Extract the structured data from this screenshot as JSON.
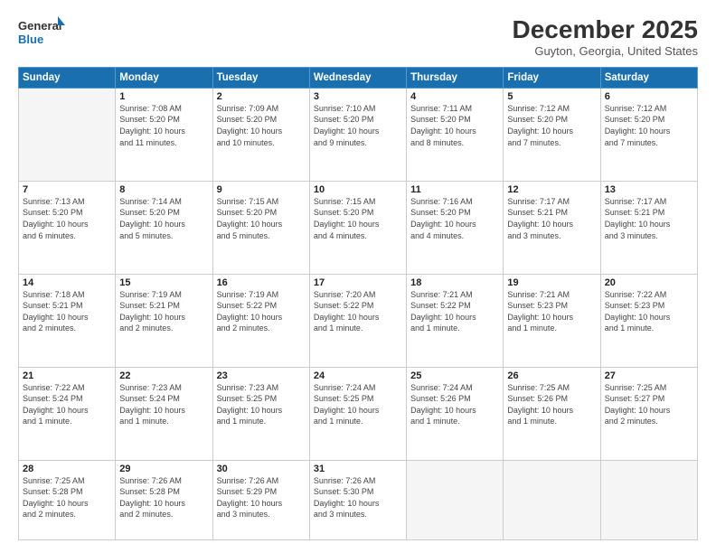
{
  "logo": {
    "line1": "General",
    "line2": "Blue"
  },
  "header": {
    "month": "December 2025",
    "location": "Guyton, Georgia, United States"
  },
  "weekdays": [
    "Sunday",
    "Monday",
    "Tuesday",
    "Wednesday",
    "Thursday",
    "Friday",
    "Saturday"
  ],
  "weeks": [
    [
      {
        "day": "",
        "info": ""
      },
      {
        "day": "1",
        "info": "Sunrise: 7:08 AM\nSunset: 5:20 PM\nDaylight: 10 hours\nand 11 minutes."
      },
      {
        "day": "2",
        "info": "Sunrise: 7:09 AM\nSunset: 5:20 PM\nDaylight: 10 hours\nand 10 minutes."
      },
      {
        "day": "3",
        "info": "Sunrise: 7:10 AM\nSunset: 5:20 PM\nDaylight: 10 hours\nand 9 minutes."
      },
      {
        "day": "4",
        "info": "Sunrise: 7:11 AM\nSunset: 5:20 PM\nDaylight: 10 hours\nand 8 minutes."
      },
      {
        "day": "5",
        "info": "Sunrise: 7:12 AM\nSunset: 5:20 PM\nDaylight: 10 hours\nand 7 minutes."
      },
      {
        "day": "6",
        "info": "Sunrise: 7:12 AM\nSunset: 5:20 PM\nDaylight: 10 hours\nand 7 minutes."
      }
    ],
    [
      {
        "day": "7",
        "info": "Sunrise: 7:13 AM\nSunset: 5:20 PM\nDaylight: 10 hours\nand 6 minutes."
      },
      {
        "day": "8",
        "info": "Sunrise: 7:14 AM\nSunset: 5:20 PM\nDaylight: 10 hours\nand 5 minutes."
      },
      {
        "day": "9",
        "info": "Sunrise: 7:15 AM\nSunset: 5:20 PM\nDaylight: 10 hours\nand 5 minutes."
      },
      {
        "day": "10",
        "info": "Sunrise: 7:15 AM\nSunset: 5:20 PM\nDaylight: 10 hours\nand 4 minutes."
      },
      {
        "day": "11",
        "info": "Sunrise: 7:16 AM\nSunset: 5:20 PM\nDaylight: 10 hours\nand 4 minutes."
      },
      {
        "day": "12",
        "info": "Sunrise: 7:17 AM\nSunset: 5:21 PM\nDaylight: 10 hours\nand 3 minutes."
      },
      {
        "day": "13",
        "info": "Sunrise: 7:17 AM\nSunset: 5:21 PM\nDaylight: 10 hours\nand 3 minutes."
      }
    ],
    [
      {
        "day": "14",
        "info": "Sunrise: 7:18 AM\nSunset: 5:21 PM\nDaylight: 10 hours\nand 2 minutes."
      },
      {
        "day": "15",
        "info": "Sunrise: 7:19 AM\nSunset: 5:21 PM\nDaylight: 10 hours\nand 2 minutes."
      },
      {
        "day": "16",
        "info": "Sunrise: 7:19 AM\nSunset: 5:22 PM\nDaylight: 10 hours\nand 2 minutes."
      },
      {
        "day": "17",
        "info": "Sunrise: 7:20 AM\nSunset: 5:22 PM\nDaylight: 10 hours\nand 1 minute."
      },
      {
        "day": "18",
        "info": "Sunrise: 7:21 AM\nSunset: 5:22 PM\nDaylight: 10 hours\nand 1 minute."
      },
      {
        "day": "19",
        "info": "Sunrise: 7:21 AM\nSunset: 5:23 PM\nDaylight: 10 hours\nand 1 minute."
      },
      {
        "day": "20",
        "info": "Sunrise: 7:22 AM\nSunset: 5:23 PM\nDaylight: 10 hours\nand 1 minute."
      }
    ],
    [
      {
        "day": "21",
        "info": "Sunrise: 7:22 AM\nSunset: 5:24 PM\nDaylight: 10 hours\nand 1 minute."
      },
      {
        "day": "22",
        "info": "Sunrise: 7:23 AM\nSunset: 5:24 PM\nDaylight: 10 hours\nand 1 minute."
      },
      {
        "day": "23",
        "info": "Sunrise: 7:23 AM\nSunset: 5:25 PM\nDaylight: 10 hours\nand 1 minute."
      },
      {
        "day": "24",
        "info": "Sunrise: 7:24 AM\nSunset: 5:25 PM\nDaylight: 10 hours\nand 1 minute."
      },
      {
        "day": "25",
        "info": "Sunrise: 7:24 AM\nSunset: 5:26 PM\nDaylight: 10 hours\nand 1 minute."
      },
      {
        "day": "26",
        "info": "Sunrise: 7:25 AM\nSunset: 5:26 PM\nDaylight: 10 hours\nand 1 minute."
      },
      {
        "day": "27",
        "info": "Sunrise: 7:25 AM\nSunset: 5:27 PM\nDaylight: 10 hours\nand 2 minutes."
      }
    ],
    [
      {
        "day": "28",
        "info": "Sunrise: 7:25 AM\nSunset: 5:28 PM\nDaylight: 10 hours\nand 2 minutes."
      },
      {
        "day": "29",
        "info": "Sunrise: 7:26 AM\nSunset: 5:28 PM\nDaylight: 10 hours\nand 2 minutes."
      },
      {
        "day": "30",
        "info": "Sunrise: 7:26 AM\nSunset: 5:29 PM\nDaylight: 10 hours\nand 3 minutes."
      },
      {
        "day": "31",
        "info": "Sunrise: 7:26 AM\nSunset: 5:30 PM\nDaylight: 10 hours\nand 3 minutes."
      },
      {
        "day": "",
        "info": ""
      },
      {
        "day": "",
        "info": ""
      },
      {
        "day": "",
        "info": ""
      }
    ]
  ]
}
